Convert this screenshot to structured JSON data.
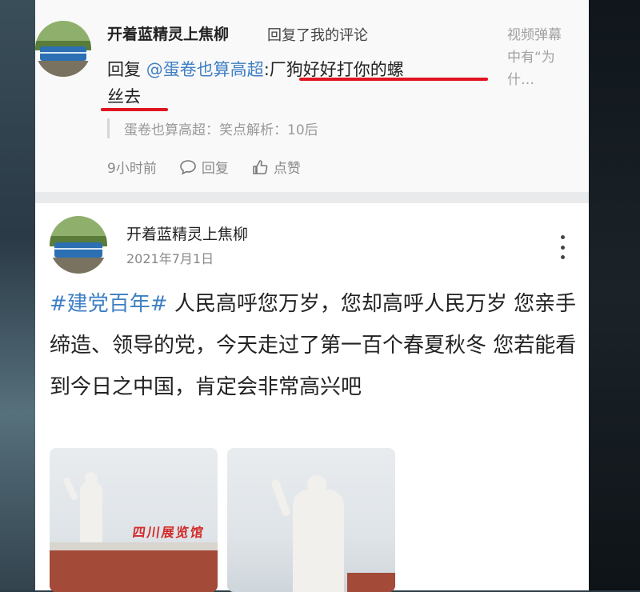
{
  "notification": {
    "user_name": "开着蓝精灵上焦柳",
    "action_text": "回复了我的评论",
    "reply_prefix": "回复 ",
    "mention": "@蛋卷也算高超",
    "reply_content_line1": ":厂狗好好打你的螺",
    "reply_content_line2": "丝去",
    "quoted_comment": "蛋卷也算高超：笑点解析：10后",
    "time_ago": "9小时前",
    "reply_label": "回复",
    "like_label": "点赞",
    "video_note": "视频弹幕中有“为什…"
  },
  "post": {
    "user_name": "开着蓝精灵上焦柳",
    "date": "2021年7月1日",
    "hashtag": "#建党百年#",
    "body": "  人民高呼您万岁，您却高呼人民万岁   您亲手缔造、领导的党，今天走过了第一百个春夏秋冬   您若能看到今日之中国，肯定会非常高兴吧",
    "photo_sign_text": "四川展览馆"
  },
  "colors": {
    "mention_blue": "#3e7fc4",
    "highlight_red": "#e0141f"
  },
  "icons": [
    "comment-icon",
    "thumbs-up-icon",
    "more-vertical-icon"
  ]
}
